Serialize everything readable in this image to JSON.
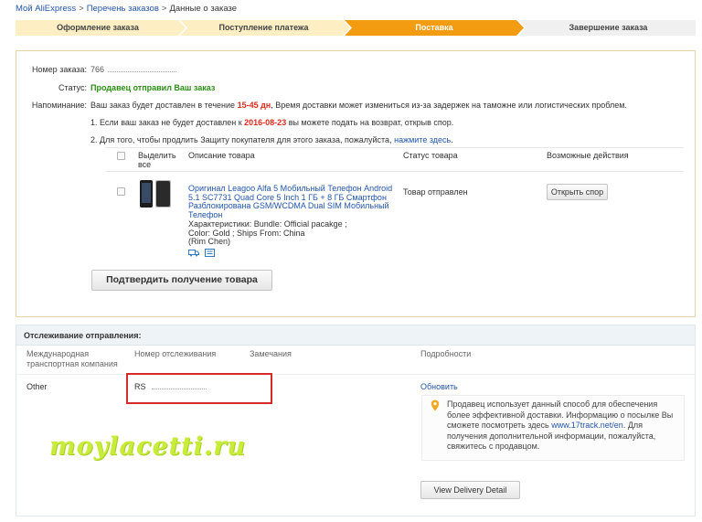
{
  "breadcrumb": {
    "my_aliexpress": "Мой AliExpress",
    "orders_list": "Перечень заказов",
    "current": "Данные о заказе",
    "separator": ">"
  },
  "steps": [
    {
      "label": "Оформление заказа",
      "state": "done"
    },
    {
      "label": "Поступление платежа",
      "state": "done"
    },
    {
      "label": "Поставка",
      "state": "active"
    },
    {
      "label": "Завершение заказа",
      "state": "pending"
    }
  ],
  "colors": {
    "step_done": "#fdeec4",
    "step_active": "#f39c12",
    "step_pending": "#f0f0f0",
    "status_green": "#2a8f13",
    "highlight_red": "#e0291e",
    "link": "#2255aa",
    "annotation_red": "#d52a2a",
    "watermark": "#c8ec3a"
  },
  "order": {
    "number_label": "Номер заказа:",
    "number_value": "766",
    "status_label": "Статус:",
    "status_value": "Продавец отправил Ваш заказ",
    "reminder_label": "Напоминание:",
    "reminder_text_1": "Ваш заказ будет доставлен в течение",
    "reminder_days": "15-45 дн",
    "reminder_text_2": ", Время доставки может измениться из-за задержек на таможне или логистических проблем.",
    "note1_text_1": "1. Если ваш заказ не будет доставлен к",
    "note1_date": "2016-08-23",
    "note1_text_2": "вы можете подать на возврат, открыв спор.",
    "note2_text": "2. Для того, чтобы продлить Защиту покупателя для этого заказа, пожалуйста,",
    "note2_link": "нажмите здесь",
    "note2_end": "."
  },
  "table": {
    "headers": {
      "select_all": "Выделить все",
      "description": "Описание товара",
      "status": "Статус товара",
      "actions": "Возможные действия"
    },
    "rows": [
      {
        "title": "Оригинал Leagoo Alfa 5 Мобильный Телефон Android 5.1 SC7731 Quad Core 5 Inch 1 ГБ + 8 ГБ Смартфон Разблокирована GSM/WCDMA Dual SIM Мобильный Телефон",
        "attributes": "Характеристики: Bundle: Official pacakge   ; Color: Gold   ; Ships From: China",
        "seller": "(Rim Chen)",
        "status": "Товар отправлен",
        "action": "Открыть спор",
        "icons": [
          "truck-icon",
          "message-icon"
        ]
      }
    ]
  },
  "confirm_button": "Подтвердить получение товара",
  "tracking": {
    "title": "Отслеживание отправления:",
    "headers": {
      "company": "Международная транспортная компания",
      "number": "Номер отслеживания",
      "remarks": "Замечания",
      "details": "Подробности"
    },
    "row": {
      "company": "Other",
      "number": "RS",
      "update_link": "Обновить"
    },
    "info_text_1": "Продавец использует данный способ для обеспечения более эффективной доставки. Информацию о посылке Вы сможете посмотреть здесь",
    "info_link": "www.17track.net/en",
    "info_text_2": ". Для получения дополнительной информации, пожалуйста, свяжитесь с продавцом.",
    "delivery_button": "View Delivery Detail"
  },
  "watermark": "moylacetti.ru"
}
